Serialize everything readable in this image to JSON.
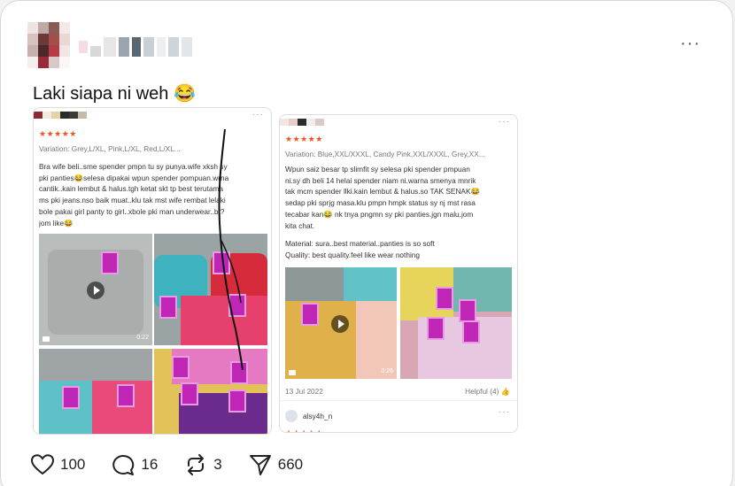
{
  "post": {
    "caption": "Laki siapa ni weh 😂",
    "menu_icon": "more-dots-icon",
    "more_glyph": "···"
  },
  "review1": {
    "variation": "Variation: Grey,L/XL, Pink,L/XL, Red,L/XL...",
    "body": [
      "Bra wife beli..sme spender pmpn tu sy punya.wife xksh sy",
      "pki panties😂selesa dipakai wpun spender pompuan.wrna",
      "cantik..kain lembut & halus.tgh ketat skt tp best terutama",
      "ms pki jeans.nso baik muat..klu tak mst wife rembat lelaki",
      "bole pakai girl panty to girl..xbole pki man underwear..bt?",
      "jom like😂"
    ],
    "video_duration": "0:22"
  },
  "review2": {
    "variation": "Variation: Blue,XXL/XXXL, Candy Pink,XXL/XXXL, Grey,XX...",
    "body": [
      "Wpun saiz besar tp slimfit sy selesa pki spender pmpuan",
      "ni.sy dh beli 14 helai spender niam ni.warna smenya mnrik",
      "tak mcm spender llki.kain lembut & halus.so TAK SENAK😂",
      "sedap pki sprjg masa.klu pmpn hmpk status sy nj mst rasa",
      "tecabar kan😂 nk tnya pngmn sy pki panties.jgn malu.jom",
      "kita chat."
    ],
    "material": "Material: sura..best material..panties is so soft",
    "quality": "Quality: best quality.feel like wear nothing",
    "video_duration": "0:26",
    "date": "13 Jul 2022",
    "helpful": "Helpful (4) 👍",
    "reviewer": "alsy4h_n"
  },
  "actions": {
    "likes": "100",
    "replies": "16",
    "reposts": "3",
    "shares": "660"
  },
  "colors": {
    "stars": "#f4511e",
    "tag": "#c026b6"
  }
}
